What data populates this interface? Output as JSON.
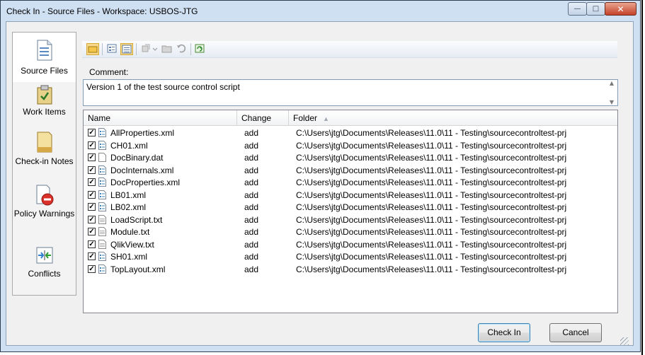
{
  "window": {
    "title": "Check In - Source Files - Workspace: USBOS-JTG",
    "controls": {
      "minimize": "minimize-icon",
      "maximize": "maximize-icon",
      "close": "close-icon"
    }
  },
  "sidebar": {
    "items": [
      {
        "label": "Source Files",
        "icon": "source-files-icon",
        "active": true
      },
      {
        "label": "Work Items",
        "icon": "work-items-icon",
        "active": false
      },
      {
        "label": "Check-in Notes",
        "icon": "checkin-notes-icon",
        "active": false
      },
      {
        "label": "Policy Warnings",
        "icon": "policy-warnings-icon",
        "active": false
      },
      {
        "label": "Conflicts",
        "icon": "conflicts-icon",
        "active": false
      }
    ]
  },
  "toolbar": {
    "buttons": [
      "comment-view-icon",
      "flat-view-icon",
      "list-view-icon",
      "compare-icon",
      "open-folder-icon",
      "undo-icon",
      "refresh-icon"
    ]
  },
  "comment": {
    "label": "Comment:",
    "value": "Version 1 of the test source control script"
  },
  "table": {
    "columns": [
      "Name",
      "Change",
      "Folder"
    ],
    "sort_column": "Folder",
    "rows": [
      {
        "name": "AllProperties.xml",
        "change": "add",
        "folder": "C:\\Users\\jtg\\Documents\\Releases\\11.0\\11 - Testing\\sourcecontroltest-prj",
        "checked": true,
        "icon": "xml-file-icon"
      },
      {
        "name": "CH01.xml",
        "change": "add",
        "folder": "C:\\Users\\jtg\\Documents\\Releases\\11.0\\11 - Testing\\sourcecontroltest-prj",
        "checked": true,
        "icon": "xml-file-icon"
      },
      {
        "name": "DocBinary.dat",
        "change": "add",
        "folder": "C:\\Users\\jtg\\Documents\\Releases\\11.0\\11 - Testing\\sourcecontroltest-prj",
        "checked": true,
        "icon": "blank-file-icon"
      },
      {
        "name": "DocInternals.xml",
        "change": "add",
        "folder": "C:\\Users\\jtg\\Documents\\Releases\\11.0\\11 - Testing\\sourcecontroltest-prj",
        "checked": true,
        "icon": "xml-file-icon"
      },
      {
        "name": "DocProperties.xml",
        "change": "add",
        "folder": "C:\\Users\\jtg\\Documents\\Releases\\11.0\\11 - Testing\\sourcecontroltest-prj",
        "checked": true,
        "icon": "xml-file-icon"
      },
      {
        "name": "LB01.xml",
        "change": "add",
        "folder": "C:\\Users\\jtg\\Documents\\Releases\\11.0\\11 - Testing\\sourcecontroltest-prj",
        "checked": true,
        "icon": "xml-file-icon"
      },
      {
        "name": "LB02.xml",
        "change": "add",
        "folder": "C:\\Users\\jtg\\Documents\\Releases\\11.0\\11 - Testing\\sourcecontroltest-prj",
        "checked": true,
        "icon": "xml-file-icon"
      },
      {
        "name": "LoadScript.txt",
        "change": "add",
        "folder": "C:\\Users\\jtg\\Documents\\Releases\\11.0\\11 - Testing\\sourcecontroltest-prj",
        "checked": true,
        "icon": "text-file-icon"
      },
      {
        "name": "Module.txt",
        "change": "add",
        "folder": "C:\\Users\\jtg\\Documents\\Releases\\11.0\\11 - Testing\\sourcecontroltest-prj",
        "checked": true,
        "icon": "text-file-icon"
      },
      {
        "name": "QlikView.txt",
        "change": "add",
        "folder": "C:\\Users\\jtg\\Documents\\Releases\\11.0\\11 - Testing\\sourcecontroltest-prj",
        "checked": true,
        "icon": "text-file-icon"
      },
      {
        "name": "SH01.xml",
        "change": "add",
        "folder": "C:\\Users\\jtg\\Documents\\Releases\\11.0\\11 - Testing\\sourcecontroltest-prj",
        "checked": true,
        "icon": "xml-file-icon"
      },
      {
        "name": "TopLayout.xml",
        "change": "add",
        "folder": "C:\\Users\\jtg\\Documents\\Releases\\11.0\\11 - Testing\\sourcecontroltest-prj",
        "checked": true,
        "icon": "xml-file-icon"
      }
    ]
  },
  "buttons": {
    "checkin": "Check In",
    "cancel": "Cancel"
  },
  "colors": {
    "frame": "#cfe0f2",
    "accent": "#3c7fb1",
    "selected_tool": "#f8d98c"
  }
}
